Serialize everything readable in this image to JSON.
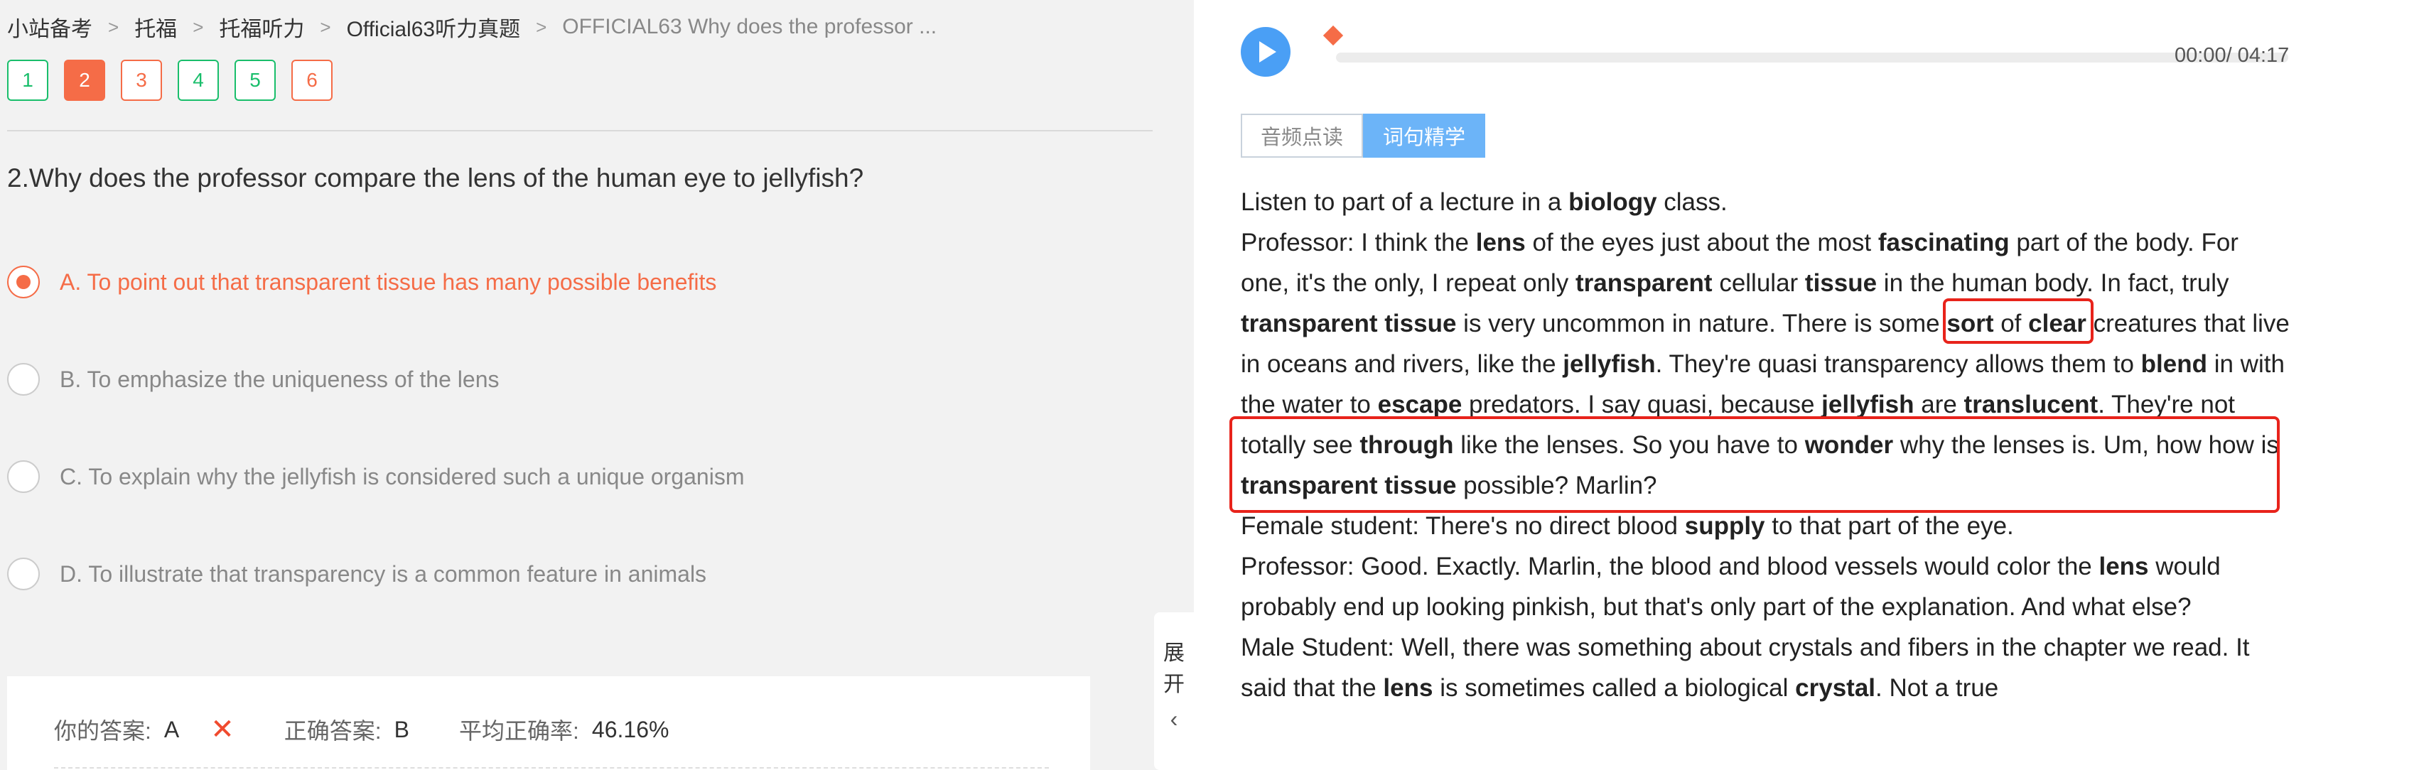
{
  "breadcrumb": [
    {
      "label": "小站备考"
    },
    {
      "label": "托福"
    },
    {
      "label": "托福听力"
    },
    {
      "label": "Official63听力真题"
    },
    {
      "label": "OFFICIAL63 Why does the professor ..."
    }
  ],
  "question_nav": [
    {
      "label": "1",
      "status": "correct"
    },
    {
      "label": "2",
      "status": "current"
    },
    {
      "label": "3",
      "status": "wrong"
    },
    {
      "label": "4",
      "status": "correct"
    },
    {
      "label": "5",
      "status": "correct"
    },
    {
      "label": "6",
      "status": "wrong"
    }
  ],
  "question": {
    "text": "2.Why does the professor compare the lens of the human eye to jellyfish?",
    "options": [
      {
        "label": "A. To point out that transparent tissue has many possible benefits",
        "selected": true
      },
      {
        "label": "B. To emphasize the uniqueness of the lens",
        "selected": false
      },
      {
        "label": "C. To explain why the jellyfish is considered such a unique organism",
        "selected": false
      },
      {
        "label": "D. To illustrate that transparency is a common feature in animals",
        "selected": false
      }
    ]
  },
  "answer": {
    "your_label": "你的答案:",
    "your_value": "A",
    "wrong_mark": "✕",
    "correct_label": "正确答案:",
    "correct_value": "B",
    "avg_label": "平均正确率:",
    "avg_value": "46.16%"
  },
  "expand": {
    "char1": "展",
    "char2": "开",
    "chevron": "‹"
  },
  "player": {
    "time": "00:00/ 04:17",
    "progress": 0
  },
  "tabs": [
    {
      "label": "音频点读",
      "active": false
    },
    {
      "label": "词句精学",
      "active": true
    }
  ],
  "colors": {
    "accent": "#4a9ff5",
    "wrong": "#f56c47",
    "correct": "#19be6b",
    "highlight": "#e8231b"
  },
  "transcript_html": [
    "Listen to part of a lecture in a <b>biology</b> class.",
    "Professor: I think the <b>lens</b> of the eyes just about the most <b>fascinating</b> part of the body. For one, it's the only, I repeat only <b>transparent</b> cellular <b>tissue</b> in the human body. In fact, truly <b>transparent tissue</b> is very uncommon in nature. There is some <b>sort</b> of <b>clear</b> creatures that live in oceans and rivers, like the <b>jellyfish</b>. They're quasi transparency allows them to <b>blend</b> in with the water to <b>escape</b> predators. I say quasi, because <b>jellyfish</b> are <b>translucent</b>. They're not totally see <b>through</b> like the lenses. So you have to <b>wonder</b> why the lenses is. Um, how how is <b>transparent tissue</b> possible? Marlin?",
    "Female student: There's no direct blood <b>supply</b> to that part of the eye.",
    "Professor: Good. Exactly. Marlin, the blood and blood vessels would color the <b>lens</b> would probably end up looking pinkish, but that's only part of the explanation. And what else?",
    "Male Student: Well, there was something about crystals and fibers in the chapter we read. It said that the <b>lens</b> is sometimes called a biological <b>crystal</b>. Not a true"
  ]
}
